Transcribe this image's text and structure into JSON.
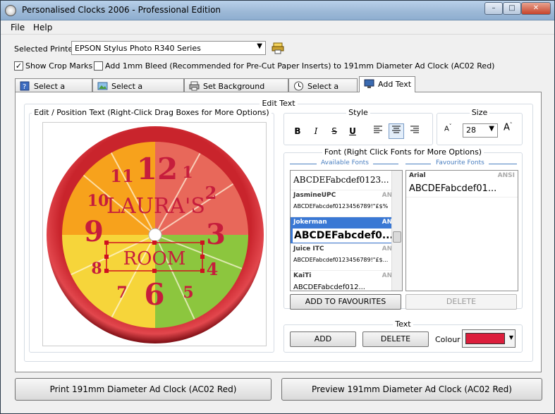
{
  "window": {
    "title": "Personalised Clocks 2006 - Professional Edition",
    "minimize": "–",
    "maximize": "□",
    "close": "✕"
  },
  "menu": {
    "file": "File",
    "help": "Help"
  },
  "printer": {
    "label": "Selected Printer",
    "value": "EPSON Stylus Photo R340 Series"
  },
  "options": {
    "crop_marks": {
      "label": "Show Crop Marks",
      "checked": true
    },
    "bleed": {
      "label": "Add 1mm Bleed (Recommended for Pre-Cut Paper Inserts) to 191mm Diameter Ad Clock (AC02 Red)",
      "checked": false
    }
  },
  "tabs": [
    {
      "label": "Select a Format"
    },
    {
      "label": "Select a Background"
    },
    {
      "label": "Set Background Position"
    },
    {
      "label": "Select a Style"
    },
    {
      "label": "Add Text"
    }
  ],
  "edit_text": {
    "title": "Edit Text",
    "preview_label": "Edit / Position Text (Right-Click Drag Boxes for More Options)",
    "clock_numbers": [
      "12",
      "1",
      "2",
      "3",
      "4",
      "5",
      "6",
      "7",
      "8",
      "9",
      "10",
      "11"
    ],
    "text_items": [
      "LAURA'S",
      "ROOM"
    ]
  },
  "style": {
    "label": "Style",
    "bold": "B",
    "italic": "I",
    "strike": "S",
    "underline": "U"
  },
  "size": {
    "label": "Size",
    "value": "28"
  },
  "font": {
    "label": "Font (Right Click Fonts for More Options)",
    "available_label": "Available Fonts",
    "favourite_label": "Favourite Fonts",
    "available": [
      {
        "name": "",
        "type": "",
        "sample": "ABCDEFabcdef0123..."
      },
      {
        "name": "JasmineUPC",
        "type": "ANSI",
        "sample": "ABCDEFabcdef0123456789!\"£$%"
      },
      {
        "name": "Jokerman",
        "type": "ANSI",
        "sample": "ABCDEFabcdef0...",
        "selected": true
      },
      {
        "name": "Juice ITC",
        "type": "ANSI",
        "sample": "ABCDEFabcdef0123456789!\"£$..."
      },
      {
        "name": "KaiTi",
        "type": "ANSI",
        "sample": "ABCDEFabcdef012..."
      }
    ],
    "favourites": [
      {
        "name": "Arial",
        "type": "ANSI",
        "sample": "ABCDEFabcdef01..."
      }
    ],
    "add_fav_button": "ADD TO FAVOURITES",
    "delete_fav_button": "DELETE"
  },
  "text_group": {
    "label": "Text",
    "add_button": "ADD",
    "delete_button": "DELETE",
    "colour_label": "Colour",
    "colour_value": "#dc1e3c"
  },
  "bottom": {
    "print_button": "Print 191mm Diameter Ad Clock (AC02 Red)",
    "preview_button": "Preview 191mm Diameter Ad Clock (AC02 Red)"
  }
}
